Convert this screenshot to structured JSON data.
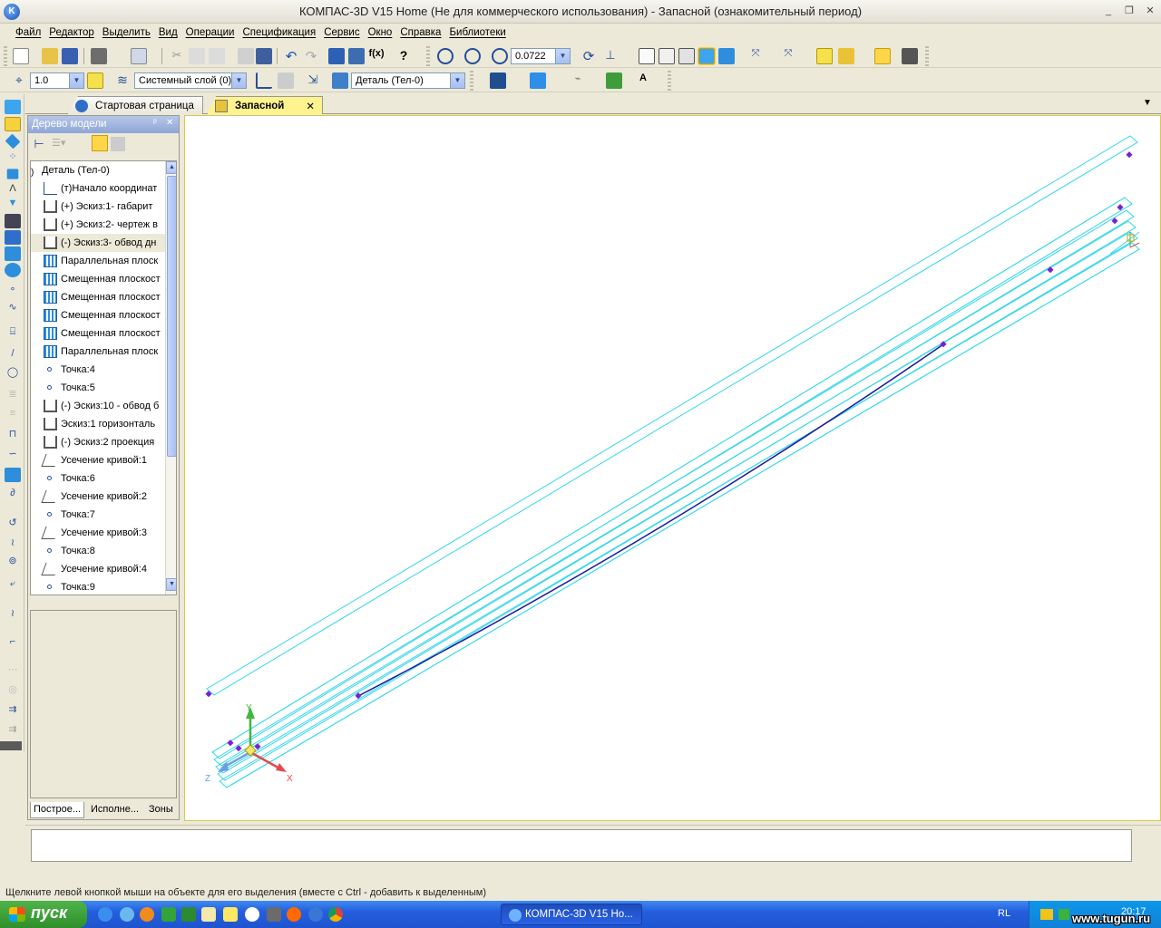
{
  "window": {
    "title": "КОМПАС-3D V15 Home (Не для коммерческого использования) - Запасной (ознакомительный период)",
    "minimize_glyph": "_",
    "restore_glyph": "❐",
    "close_glyph": "✕"
  },
  "menu": [
    "Файл",
    "Редактор",
    "Выделить",
    "Вид",
    "Операции",
    "Спецификация",
    "Сервис",
    "Окно",
    "Справка",
    "Библиотеки"
  ],
  "toolbar1": {
    "zoom_value": "0.0722",
    "fx_label": "f(x)"
  },
  "toolbar2": {
    "step_value": "1.0",
    "layer_value": "Системный слой (0)",
    "part_value": "Деталь (Тел-0)"
  },
  "tabs": [
    {
      "label": "Стартовая страница",
      "icon": "kompas-logo-icon"
    },
    {
      "label": "Запасной",
      "icon": "part-icon",
      "close": "✕"
    }
  ],
  "tree": {
    "title": "Дерево модели",
    "pin_glyph": "ᵖ",
    "close_glyph": "✕",
    "root": "Деталь (Тел-0)",
    "items": [
      {
        "label": "(т)Начало координат",
        "icon": "origin-icon"
      },
      {
        "label": "(+) Эскиз:1- габарит",
        "icon": "sketch-icon"
      },
      {
        "label": "(+) Эскиз:2- чертеж в",
        "icon": "sketch-icon"
      },
      {
        "label": "(-) Эскиз:3- обвод дн",
        "icon": "sketch-icon"
      },
      {
        "label": "Параллельная плоск",
        "icon": "plane-icon"
      },
      {
        "label": "Смещенная плоскост",
        "icon": "plane-icon"
      },
      {
        "label": "Смещенная плоскост",
        "icon": "plane-icon"
      },
      {
        "label": "Смещенная плоскост",
        "icon": "plane-icon"
      },
      {
        "label": "Смещенная плоскост",
        "icon": "plane-icon"
      },
      {
        "label": "Параллельная плоск",
        "icon": "plane-icon"
      },
      {
        "label": "Точка:4",
        "icon": "point-icon"
      },
      {
        "label": "Точка:5",
        "icon": "point-icon"
      },
      {
        "label": "(-) Эскиз:10 - обвод б",
        "icon": "sketch-icon"
      },
      {
        "label": "Эскиз:1 горизонталь",
        "icon": "sketch-icon"
      },
      {
        "label": "(-) Эскиз:2 проекция",
        "icon": "sketch-icon"
      },
      {
        "label": "Усечение кривой:1",
        "icon": "trim-curve-icon"
      },
      {
        "label": "Точка:6",
        "icon": "point-icon"
      },
      {
        "label": "Усечение кривой:2",
        "icon": "trim-curve-icon"
      },
      {
        "label": "Точка:7",
        "icon": "point-icon"
      },
      {
        "label": "Усечение кривой:3",
        "icon": "trim-curve-icon"
      },
      {
        "label": "Точка:8",
        "icon": "point-icon"
      },
      {
        "label": "Усечение кривой:4",
        "icon": "trim-curve-icon"
      },
      {
        "label": "Точка:9",
        "icon": "point-icon"
      }
    ],
    "bottom_tabs": [
      "Построе...",
      "Исполне...",
      "Зоны"
    ]
  },
  "viewport": {
    "axis_x": "X",
    "axis_y": "Y",
    "axis_z": "Z",
    "line_color": "#33d6ea",
    "curve_color": "#1a1a9e",
    "point_color": "#7a1fd6"
  },
  "status": {
    "hint": "Щелкните левой кнопкой мыши на объекте для его выделения (вместе с Ctrl - добавить к выделенным)"
  },
  "taskbar": {
    "start_label": "пуск",
    "task_label": "КОМПАС-3D V15 Ho...",
    "lang": "RL",
    "clock": "20:17",
    "watermark": "www.tugun.ru"
  }
}
